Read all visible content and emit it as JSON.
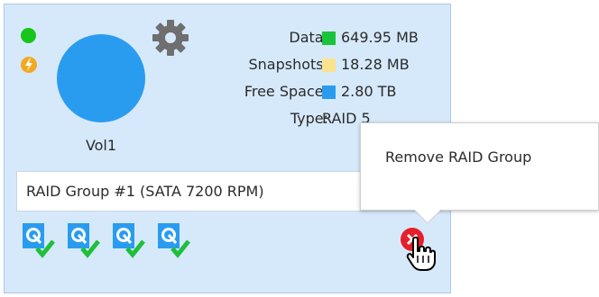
{
  "volume": {
    "name": "Vol1",
    "status_color": "#16c61a",
    "power_color": "#f2a91f",
    "circle_color": "#2a9cf0",
    "stats": [
      {
        "label": "Data:",
        "value": "649.95 MB",
        "swatch": "#19c43a"
      },
      {
        "label": "Snapshots:",
        "value": "18.28 MB",
        "swatch": "#fbe28f"
      },
      {
        "label": "Free Space:",
        "value": "2.80 TB",
        "swatch": "#2a9cf0"
      },
      {
        "label": "Type:",
        "value": "RAID 5",
        "swatch": ""
      }
    ]
  },
  "raid_group": {
    "label": "RAID Group #1 (SATA 7200 RPM)",
    "disk_count": 4
  },
  "context_menu": {
    "items": [
      {
        "label": "Remove RAID Group"
      }
    ]
  },
  "icons": {
    "settings": "gear-icon",
    "disk": "disk-check-icon",
    "remove": "remove-icon",
    "cursor": "hand-cursor-icon",
    "power": "power-icon"
  }
}
